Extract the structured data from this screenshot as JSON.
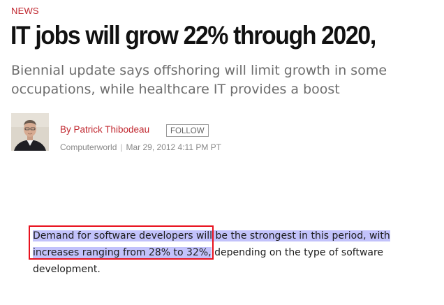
{
  "section": {
    "label": "NEWS"
  },
  "article": {
    "headline": "IT jobs will grow 22% through 2020,",
    "deck": "Biennial update says offshoring will limit growth in some occupations, while healthcare IT provides a boost",
    "author": {
      "name": "By Patrick Thibodeau",
      "follow_label": "FOLLOW",
      "publication": "Computerworld",
      "separator": "|",
      "date": "Mar 29, 2012 4:11 PM PT"
    },
    "body": {
      "selected_text": "Demand for software developers will be the strongest in this period, with increases ranging from 28% to 32%,",
      "trailing_text": " depending on the type of software development."
    }
  },
  "colors": {
    "accent_red": "#c0262e",
    "selection": "#c2c2fb",
    "annotation_box": "#e8111e"
  },
  "icons": {
    "avatar": "author-portrait"
  }
}
